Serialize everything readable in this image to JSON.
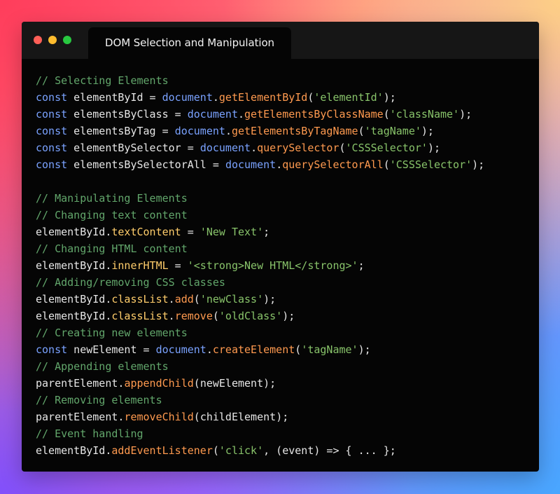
{
  "window": {
    "tab_title": "DOM Selection and Manipulation"
  },
  "colors": {
    "comment": "#62a66b",
    "keyword": "#7aa2ff",
    "method": "#ff9a4f",
    "string": "#88c36a",
    "property": "#ffcd6b",
    "text": "#e6e6e6"
  },
  "code_lines": [
    [
      {
        "t": "comment",
        "v": "// Selecting Elements"
      }
    ],
    [
      {
        "t": "keyword",
        "v": "const"
      },
      {
        "t": "ident",
        "v": " elementById = "
      },
      {
        "t": "obj",
        "v": "document"
      },
      {
        "t": "punc",
        "v": "."
      },
      {
        "t": "method",
        "v": "getElementById"
      },
      {
        "t": "punc",
        "v": "("
      },
      {
        "t": "string",
        "v": "'elementId'"
      },
      {
        "t": "punc",
        "v": ");"
      }
    ],
    [
      {
        "t": "keyword",
        "v": "const"
      },
      {
        "t": "ident",
        "v": " elementsByClass = "
      },
      {
        "t": "obj",
        "v": "document"
      },
      {
        "t": "punc",
        "v": "."
      },
      {
        "t": "method",
        "v": "getElementsByClassName"
      },
      {
        "t": "punc",
        "v": "("
      },
      {
        "t": "string",
        "v": "'className'"
      },
      {
        "t": "punc",
        "v": ");"
      }
    ],
    [
      {
        "t": "keyword",
        "v": "const"
      },
      {
        "t": "ident",
        "v": " elementsByTag = "
      },
      {
        "t": "obj",
        "v": "document"
      },
      {
        "t": "punc",
        "v": "."
      },
      {
        "t": "method",
        "v": "getElementsByTagName"
      },
      {
        "t": "punc",
        "v": "("
      },
      {
        "t": "string",
        "v": "'tagName'"
      },
      {
        "t": "punc",
        "v": ");"
      }
    ],
    [
      {
        "t": "keyword",
        "v": "const"
      },
      {
        "t": "ident",
        "v": " elementBySelector = "
      },
      {
        "t": "obj",
        "v": "document"
      },
      {
        "t": "punc",
        "v": "."
      },
      {
        "t": "method",
        "v": "querySelector"
      },
      {
        "t": "punc",
        "v": "("
      },
      {
        "t": "string",
        "v": "'CSSSelector'"
      },
      {
        "t": "punc",
        "v": ");"
      }
    ],
    [
      {
        "t": "keyword",
        "v": "const"
      },
      {
        "t": "ident",
        "v": " elementsBySelectorAll = "
      },
      {
        "t": "obj",
        "v": "document"
      },
      {
        "t": "punc",
        "v": "."
      },
      {
        "t": "method",
        "v": "querySelectorAll"
      },
      {
        "t": "punc",
        "v": "("
      },
      {
        "t": "string",
        "v": "'CSSSelector'"
      },
      {
        "t": "punc",
        "v": ");"
      }
    ],
    [],
    [
      {
        "t": "comment",
        "v": "// Manipulating Elements"
      }
    ],
    [
      {
        "t": "comment",
        "v": "// Changing text content"
      }
    ],
    [
      {
        "t": "ident",
        "v": "elementById."
      },
      {
        "t": "prop",
        "v": "textContent"
      },
      {
        "t": "ident",
        "v": " = "
      },
      {
        "t": "string",
        "v": "'New Text'"
      },
      {
        "t": "punc",
        "v": ";"
      }
    ],
    [
      {
        "t": "comment",
        "v": "// Changing HTML content"
      }
    ],
    [
      {
        "t": "ident",
        "v": "elementById."
      },
      {
        "t": "prop",
        "v": "innerHTML"
      },
      {
        "t": "ident",
        "v": " = "
      },
      {
        "t": "string",
        "v": "'<strong>New HTML</strong>'"
      },
      {
        "t": "punc",
        "v": ";"
      }
    ],
    [
      {
        "t": "comment",
        "v": "// Adding/removing CSS classes"
      }
    ],
    [
      {
        "t": "ident",
        "v": "elementById."
      },
      {
        "t": "prop",
        "v": "classList"
      },
      {
        "t": "punc",
        "v": "."
      },
      {
        "t": "method",
        "v": "add"
      },
      {
        "t": "punc",
        "v": "("
      },
      {
        "t": "string",
        "v": "'newClass'"
      },
      {
        "t": "punc",
        "v": ");"
      }
    ],
    [
      {
        "t": "ident",
        "v": "elementById."
      },
      {
        "t": "prop",
        "v": "classList"
      },
      {
        "t": "punc",
        "v": "."
      },
      {
        "t": "method",
        "v": "remove"
      },
      {
        "t": "punc",
        "v": "("
      },
      {
        "t": "string",
        "v": "'oldClass'"
      },
      {
        "t": "punc",
        "v": ");"
      }
    ],
    [
      {
        "t": "comment",
        "v": "// Creating new elements"
      }
    ],
    [
      {
        "t": "keyword",
        "v": "const"
      },
      {
        "t": "ident",
        "v": " newElement = "
      },
      {
        "t": "obj",
        "v": "document"
      },
      {
        "t": "punc",
        "v": "."
      },
      {
        "t": "method",
        "v": "createElement"
      },
      {
        "t": "punc",
        "v": "("
      },
      {
        "t": "string",
        "v": "'tagName'"
      },
      {
        "t": "punc",
        "v": ");"
      }
    ],
    [
      {
        "t": "comment",
        "v": "// Appending elements"
      }
    ],
    [
      {
        "t": "ident",
        "v": "parentElement."
      },
      {
        "t": "method",
        "v": "appendChild"
      },
      {
        "t": "punc",
        "v": "("
      },
      {
        "t": "ident",
        "v": "newElement"
      },
      {
        "t": "punc",
        "v": ");"
      }
    ],
    [
      {
        "t": "comment",
        "v": "// Removing elements"
      }
    ],
    [
      {
        "t": "ident",
        "v": "parentElement."
      },
      {
        "t": "method",
        "v": "removeChild"
      },
      {
        "t": "punc",
        "v": "("
      },
      {
        "t": "ident",
        "v": "childElement"
      },
      {
        "t": "punc",
        "v": ");"
      }
    ],
    [
      {
        "t": "comment",
        "v": "// Event handling"
      }
    ],
    [
      {
        "t": "ident",
        "v": "elementById."
      },
      {
        "t": "method",
        "v": "addEventListener"
      },
      {
        "t": "punc",
        "v": "("
      },
      {
        "t": "string",
        "v": "'click'"
      },
      {
        "t": "punc",
        "v": ", ("
      },
      {
        "t": "ident",
        "v": "event"
      },
      {
        "t": "punc",
        "v": ") => { ... };"
      }
    ]
  ]
}
